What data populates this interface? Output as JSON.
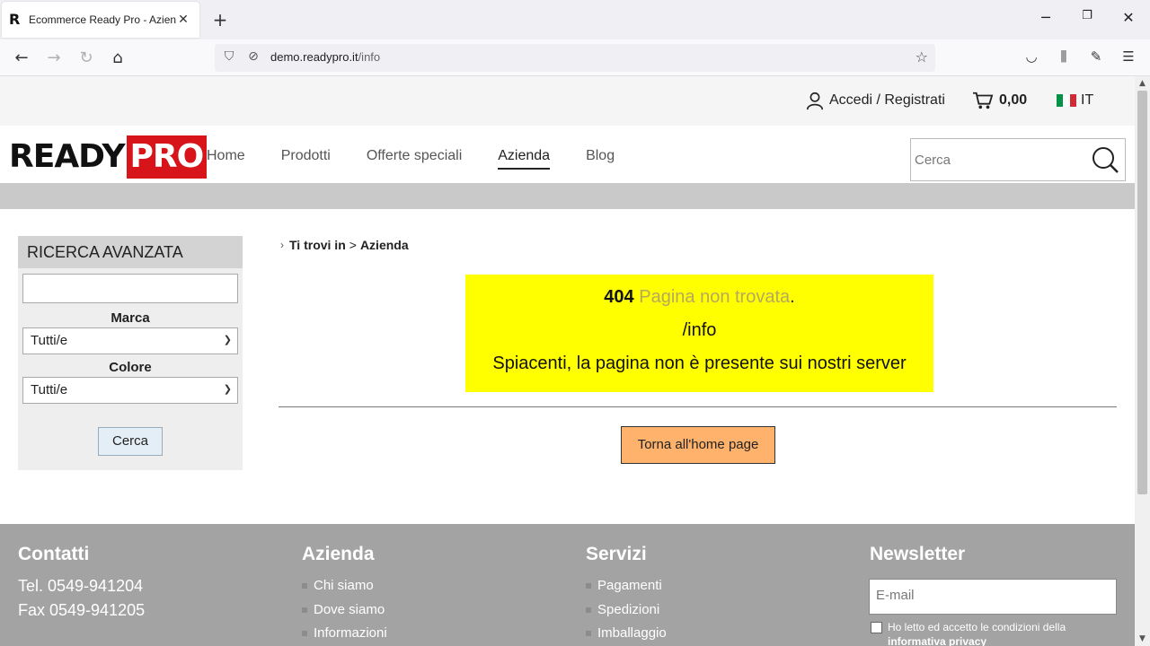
{
  "browser": {
    "tab_title": "Ecommerce Ready Pro - Azienda",
    "tab_favicon": "R",
    "url_host": "demo.readypro.it",
    "url_path": "/info"
  },
  "topbar": {
    "account_label": "Accedi / Registrati",
    "cart_total": "0,00",
    "lang": "IT"
  },
  "header": {
    "logo_part1": "READY",
    "logo_part2": "PRO",
    "menu": [
      {
        "label": "Home"
      },
      {
        "label": "Prodotti"
      },
      {
        "label": "Offerte speciali"
      },
      {
        "label": "Azienda"
      },
      {
        "label": "Blog"
      }
    ],
    "search_placeholder": "Cerca"
  },
  "sidebar": {
    "title": "RICERCA AVANZATA",
    "brand_label": "Marca",
    "brand_value": "Tutti/e",
    "color_label": "Colore",
    "color_value": "Tutti/e",
    "button_label": "Cerca"
  },
  "breadcrumb": {
    "prefix": "Ti trovi in",
    "separator": ">",
    "current": "Azienda"
  },
  "error": {
    "code": "404",
    "message": "Pagina non trovata",
    "period": ".",
    "path": "/info",
    "description": "Spiacenti, la pagina non è presente sui nostri server"
  },
  "home_button": "Torna all'home page",
  "footer": {
    "contacts": {
      "title": "Contatti",
      "phone": "Tel. 0549-941204",
      "fax": "Fax 0549-941205"
    },
    "company": {
      "title": "Azienda",
      "links": [
        "Chi siamo",
        "Dove siamo",
        "Informazioni"
      ]
    },
    "services": {
      "title": "Servizi",
      "links": [
        "Pagamenti",
        "Spedizioni",
        "Imballaggio"
      ]
    },
    "newsletter": {
      "title": "Newsletter",
      "email_placeholder": "E-mail",
      "consent_text": "Ho letto ed accetto le condizioni della",
      "consent_link": "informativa privacy"
    }
  },
  "colors": {
    "brand_red": "#d7141a",
    "error_bg": "#ffff00",
    "home_button_bg": "#ffb26b",
    "footer_bg": "#a3a3a3"
  }
}
